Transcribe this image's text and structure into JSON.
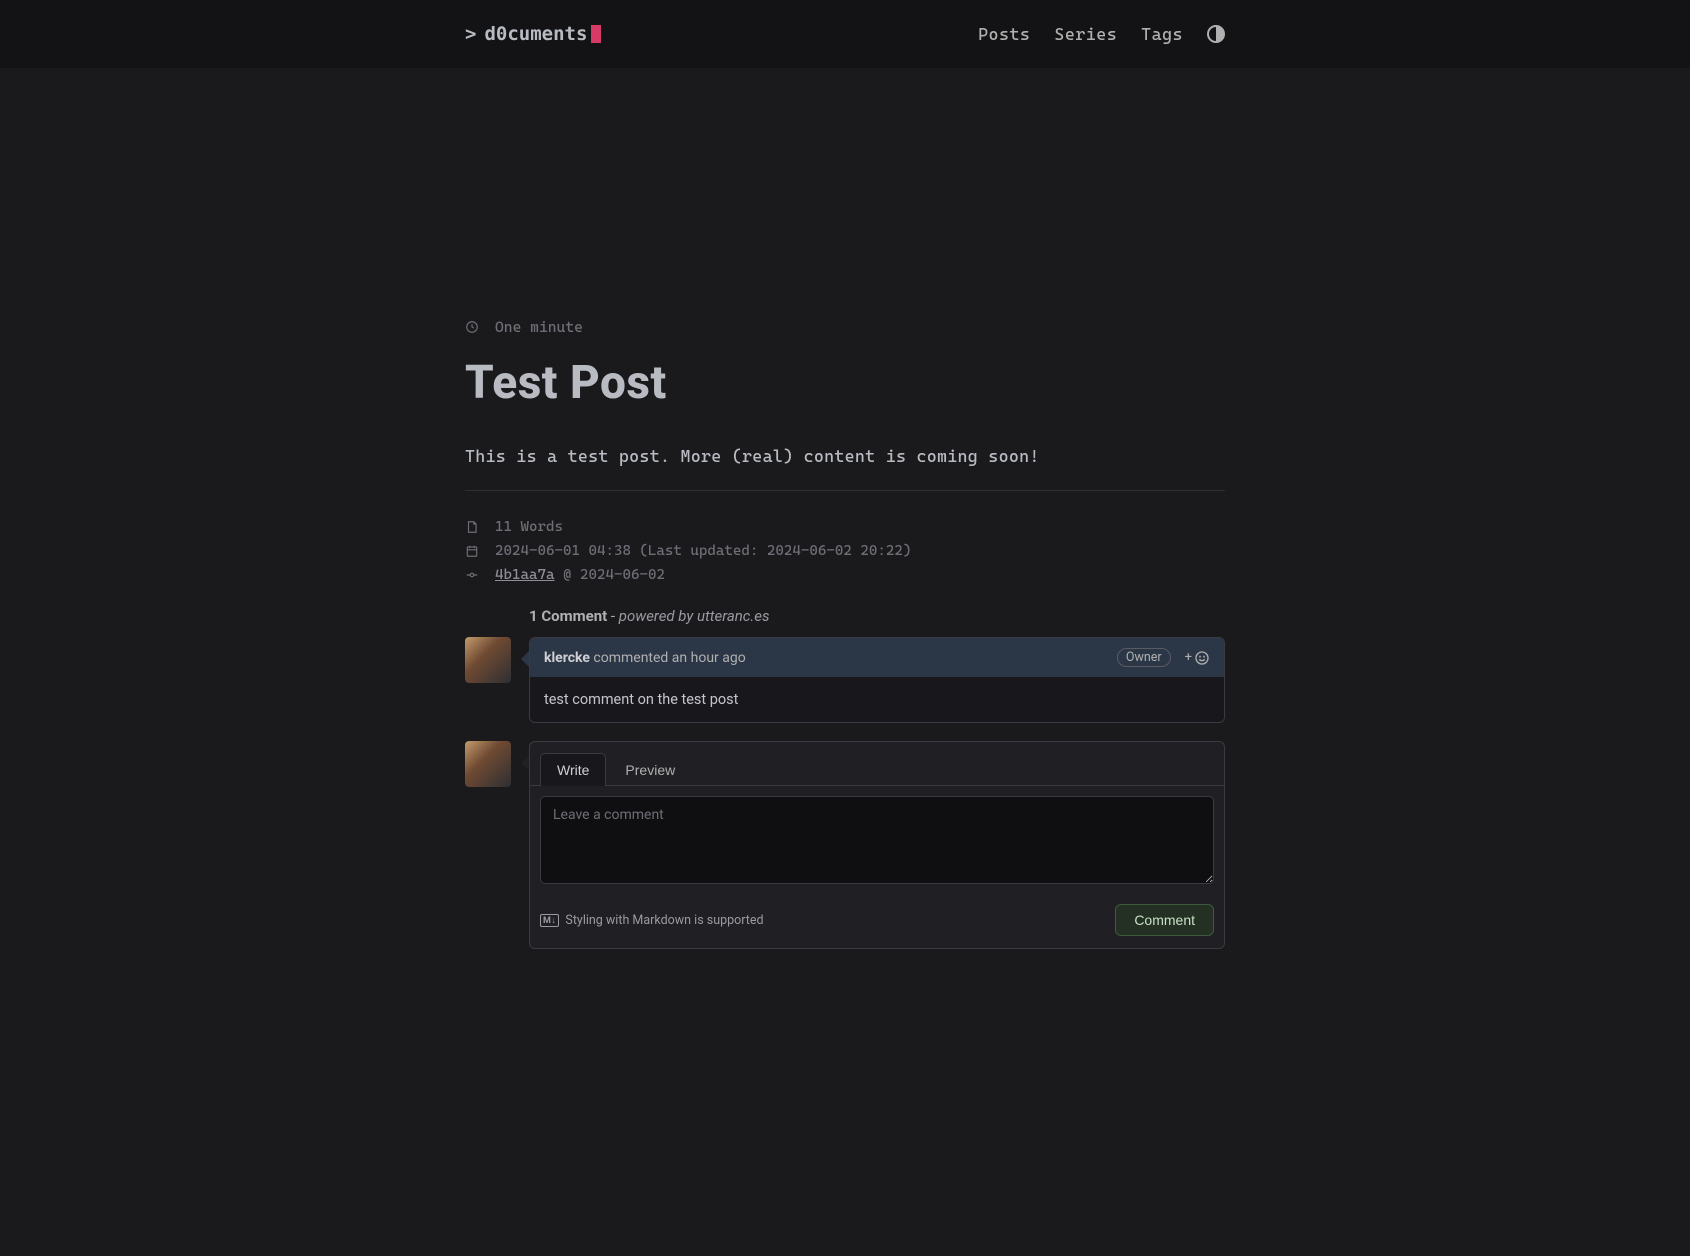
{
  "site": {
    "prompt": ">",
    "name": "d0cuments"
  },
  "nav": {
    "posts": "Posts",
    "series": "Series",
    "tags": "Tags"
  },
  "post": {
    "read_time": "One minute",
    "title": "Test Post",
    "body": "This is a test post. More (real) content is coming soon!",
    "word_count": "11 Words",
    "date_line": "2024-06-01 04:38 (Last updated: 2024-06-02 20:22)",
    "commit_hash": "4b1aa7a",
    "commit_suffix": " @ 2024-06-02"
  },
  "comments": {
    "count_label": "1 Comment",
    "dash": " - ",
    "powered_by": "powered by utteranc.es",
    "item": {
      "author": "klercke",
      "commented": " commented an hour ago",
      "owner_badge": "Owner",
      "react_plus": "+",
      "body": "test comment on the test post"
    },
    "editor": {
      "write_tab": "Write",
      "preview_tab": "Preview",
      "placeholder": "Leave a comment",
      "md_badge": "M↓",
      "md_hint": "Styling with Markdown is supported",
      "submit": "Comment"
    }
  }
}
